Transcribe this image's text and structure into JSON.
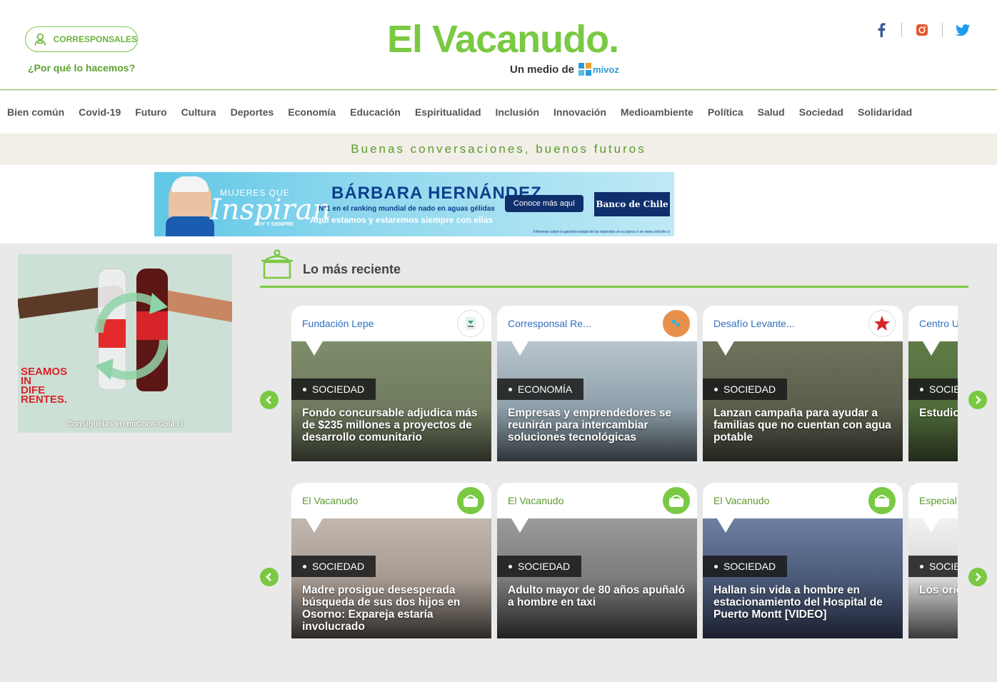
{
  "header": {
    "corresponsales_label": "CORRESPONSALES",
    "why_link": "¿Por qué lo hacemos?",
    "logo": "El Vacanudo.",
    "logo_sub": "Un medio de",
    "mivoz": "mivoz"
  },
  "nav": [
    "Bien común",
    "Covid-19",
    "Futuro",
    "Cultura",
    "Deportes",
    "Economía",
    "Educación",
    "Espiritualidad",
    "Inclusión",
    "Innovación",
    "Medioambiente",
    "Política",
    "Salud",
    "Sociedad",
    "Solidaridad"
  ],
  "tagline": "Buenas conversaciones, buenos futuros",
  "banner": {
    "mujeres": "MUJERES QUE",
    "inspiran": "Inspiran",
    "hoy": "HOY Y SIEMPRE",
    "name": "BÁRBARA HERNÁNDEZ",
    "rank": "N°1 en el ranking mundial de nado en aguas gélidas",
    "aqui": "Aquí estamos y estaremos siempre con ellas",
    "cta": "Conoce más aquí",
    "bank": "Banco de Chile",
    "disclaimer": "Infórmese sobre la garantía estatal de los depósitos en su banco o en www.cmfchile.cl"
  },
  "side_ad": {
    "seamos": [
      "SEAMOS",
      "IN",
      "DIFE",
      "RENTES."
    ],
    "consiguelas": "Consíguelas en miCoca-Cola.cl"
  },
  "section": {
    "title": "Lo más reciente"
  },
  "row1": [
    {
      "source": "Fundación Lepe",
      "category": "SOCIEDAD",
      "headline": "Fondo concursable adjudica más de $235 millones a proyectos de desarrollo comunitario",
      "bg": "#6f7a5e"
    },
    {
      "source": "Corresponsal Re...",
      "category": "ECONOMÍA",
      "headline": "Empresas y emprendedores se reunirán para intercambiar soluciones tecnológicas",
      "bg": "#8fa0ab"
    },
    {
      "source": "Desafío Levante...",
      "category": "SOCIEDAD",
      "headline": "Lanzan campaña para ayudar a familias que no cuentan con agua potable",
      "bg": "#5b5e4c"
    },
    {
      "source": "Centro U",
      "category": "SOCIE",
      "headline": "Estudio la prote",
      "bg": "#4f6b3a"
    }
  ],
  "row2": [
    {
      "source": "El Vacanudo",
      "category": "SOCIEDAD",
      "headline": "Madre prosigue desesperada búsqueda de sus dos hijos en Osorno: Expareja estaría involucrado",
      "bg": "#a69b92"
    },
    {
      "source": "El Vacanudo",
      "category": "SOCIEDAD",
      "headline": "Adulto mayor de 80 años apuñaló a hombre en taxi",
      "bg": "#7c7c7c"
    },
    {
      "source": "El Vacanudo",
      "category": "SOCIEDAD",
      "headline": "Hallan sin vida a hombre en estacionamiento del Hospital de Puerto Montt [VIDEO]",
      "bg": "#4b5a78"
    },
    {
      "source": "Especial",
      "category": "SOCIE",
      "headline": "Los orig",
      "bg": "#e8e8e8"
    }
  ],
  "colors": {
    "accent": "#7ac943",
    "link_blue": "#2f6fbf"
  }
}
